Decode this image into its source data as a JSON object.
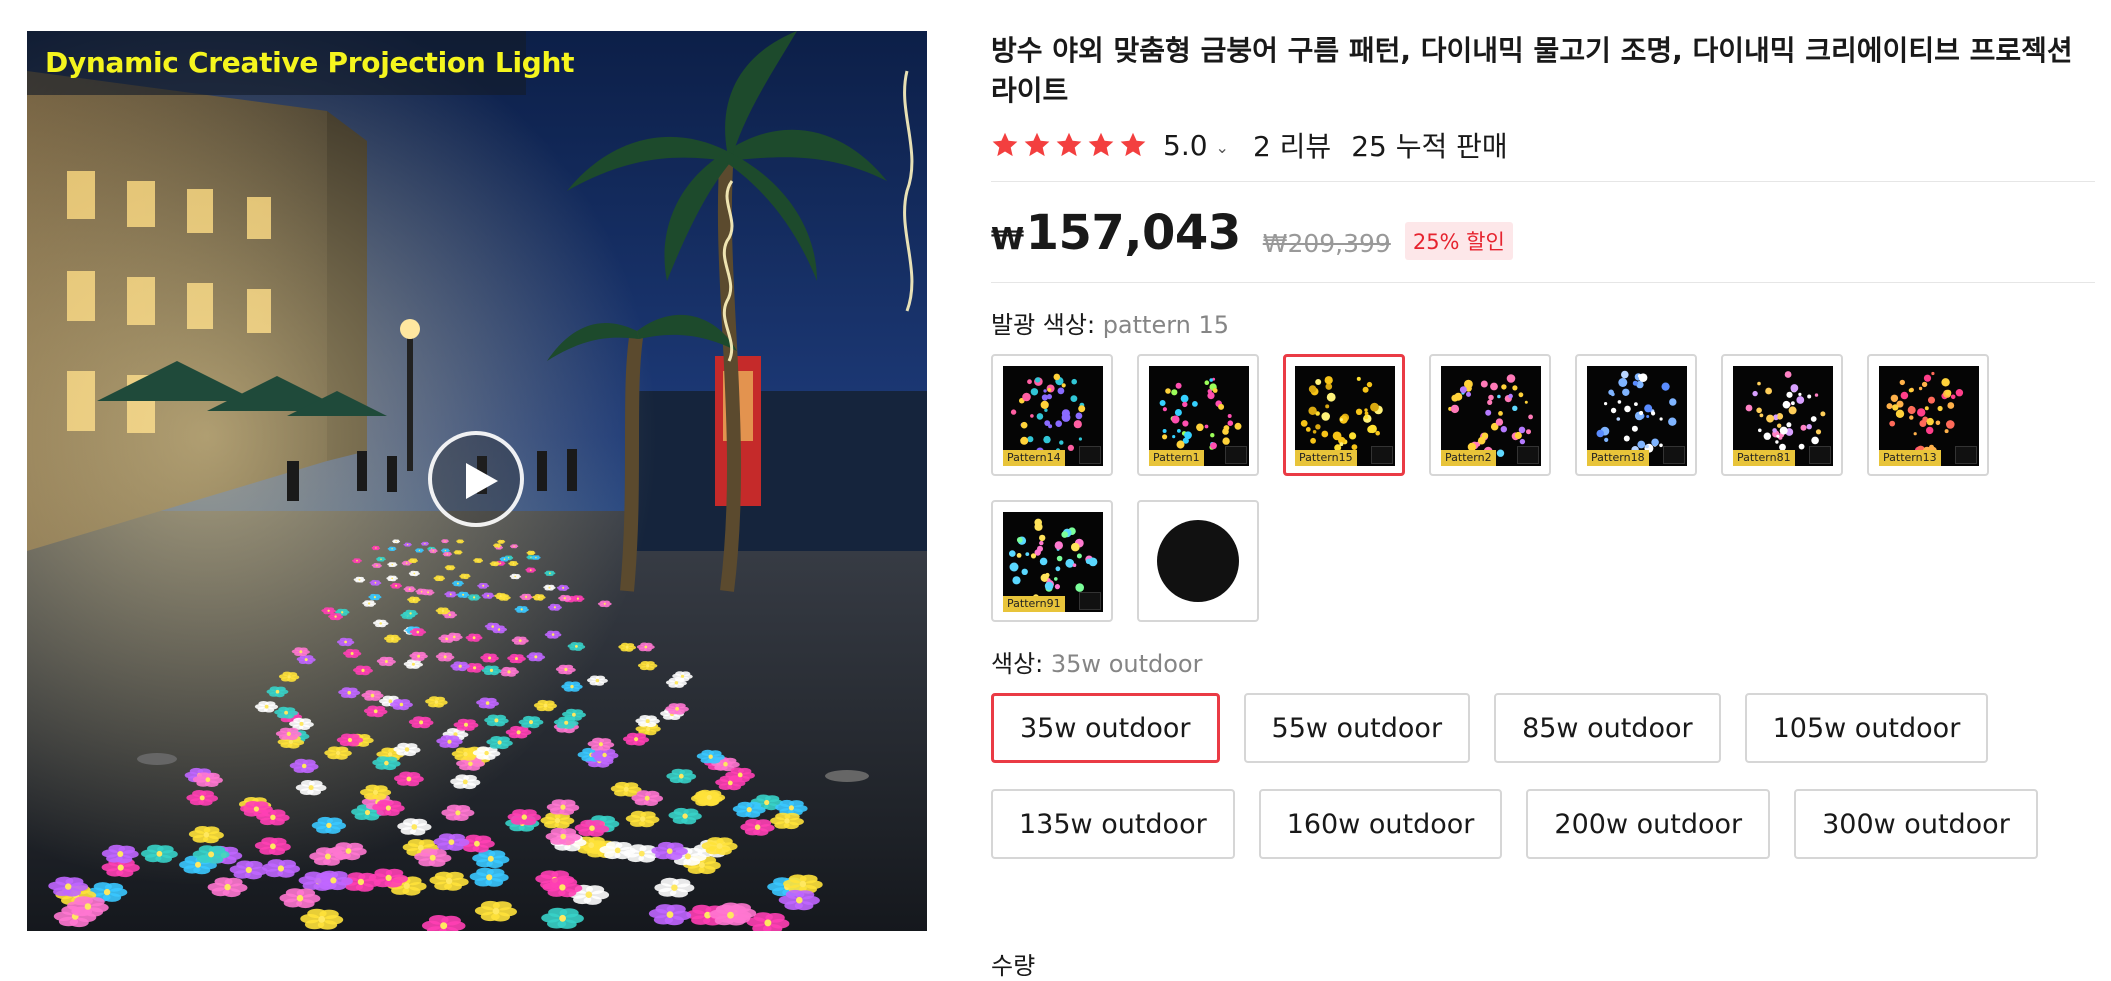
{
  "gallery": {
    "banner_text": "Dynamic Creative Projection Light",
    "play_icon": "play-icon"
  },
  "product": {
    "title": "방수 야외 맞춤형 금붕어 구름 패턴, 다이내믹 물고기 조명, 다이내믹 크리에이티브 프로젝션 라이트",
    "rating_score": "5.0",
    "rating_stars": 5,
    "chevron": "⌄",
    "reviews": "2 리뷰",
    "sold": "25 누적 판매",
    "currency": "₩",
    "price": "157,043",
    "original_price": "₩209,399",
    "discount": "25% 할인"
  },
  "pattern_option": {
    "label": "발광 색상:",
    "selected": "pattern 15",
    "items": [
      {
        "tag": "Pattern14",
        "palette": [
          "#ff5fa2",
          "#31c6d6",
          "#ffd23a",
          "#8a6bff"
        ]
      },
      {
        "tag": "Pattern1",
        "palette": [
          "#ffd23a",
          "#ff4fb0",
          "#35d1ff",
          "#9cff5a"
        ]
      },
      {
        "tag": "Pattern15",
        "palette": [
          "#ffe030",
          "#f7c418",
          "#fff27a",
          "#d9a910"
        ]
      },
      {
        "tag": "Pattern2",
        "palette": [
          "#ff7ab8",
          "#ffd23a",
          "#60d8ff",
          "#b57bff"
        ]
      },
      {
        "tag": "Pattern18",
        "palette": [
          "#7fb4ff",
          "#b8d4ff",
          "#5a8cff",
          "#ffffff"
        ]
      },
      {
        "tag": "Pattern81",
        "palette": [
          "#ff82c4",
          "#d8a0ff",
          "#ffcf5a",
          "#ffffff"
        ]
      },
      {
        "tag": "Pattern13",
        "palette": [
          "#ff6a5a",
          "#ffb14a",
          "#ff3f8a",
          "#ffd23a"
        ]
      },
      {
        "tag": "Pattern91",
        "palette": [
          "#5ad8ff",
          "#ff7ad0",
          "#ffe35a",
          "#7bff9a"
        ]
      },
      {
        "tag": "",
        "palette": []
      }
    ],
    "selected_index": 2
  },
  "size_option": {
    "label": "색상:",
    "selected": "35w outdoor",
    "items": [
      "35w outdoor",
      "55w outdoor",
      "85w outdoor",
      "105w outdoor",
      "135w outdoor",
      "160w outdoor",
      "200w outdoor",
      "300w outdoor"
    ],
    "selected_index": 0
  },
  "quantity_label": "수량"
}
